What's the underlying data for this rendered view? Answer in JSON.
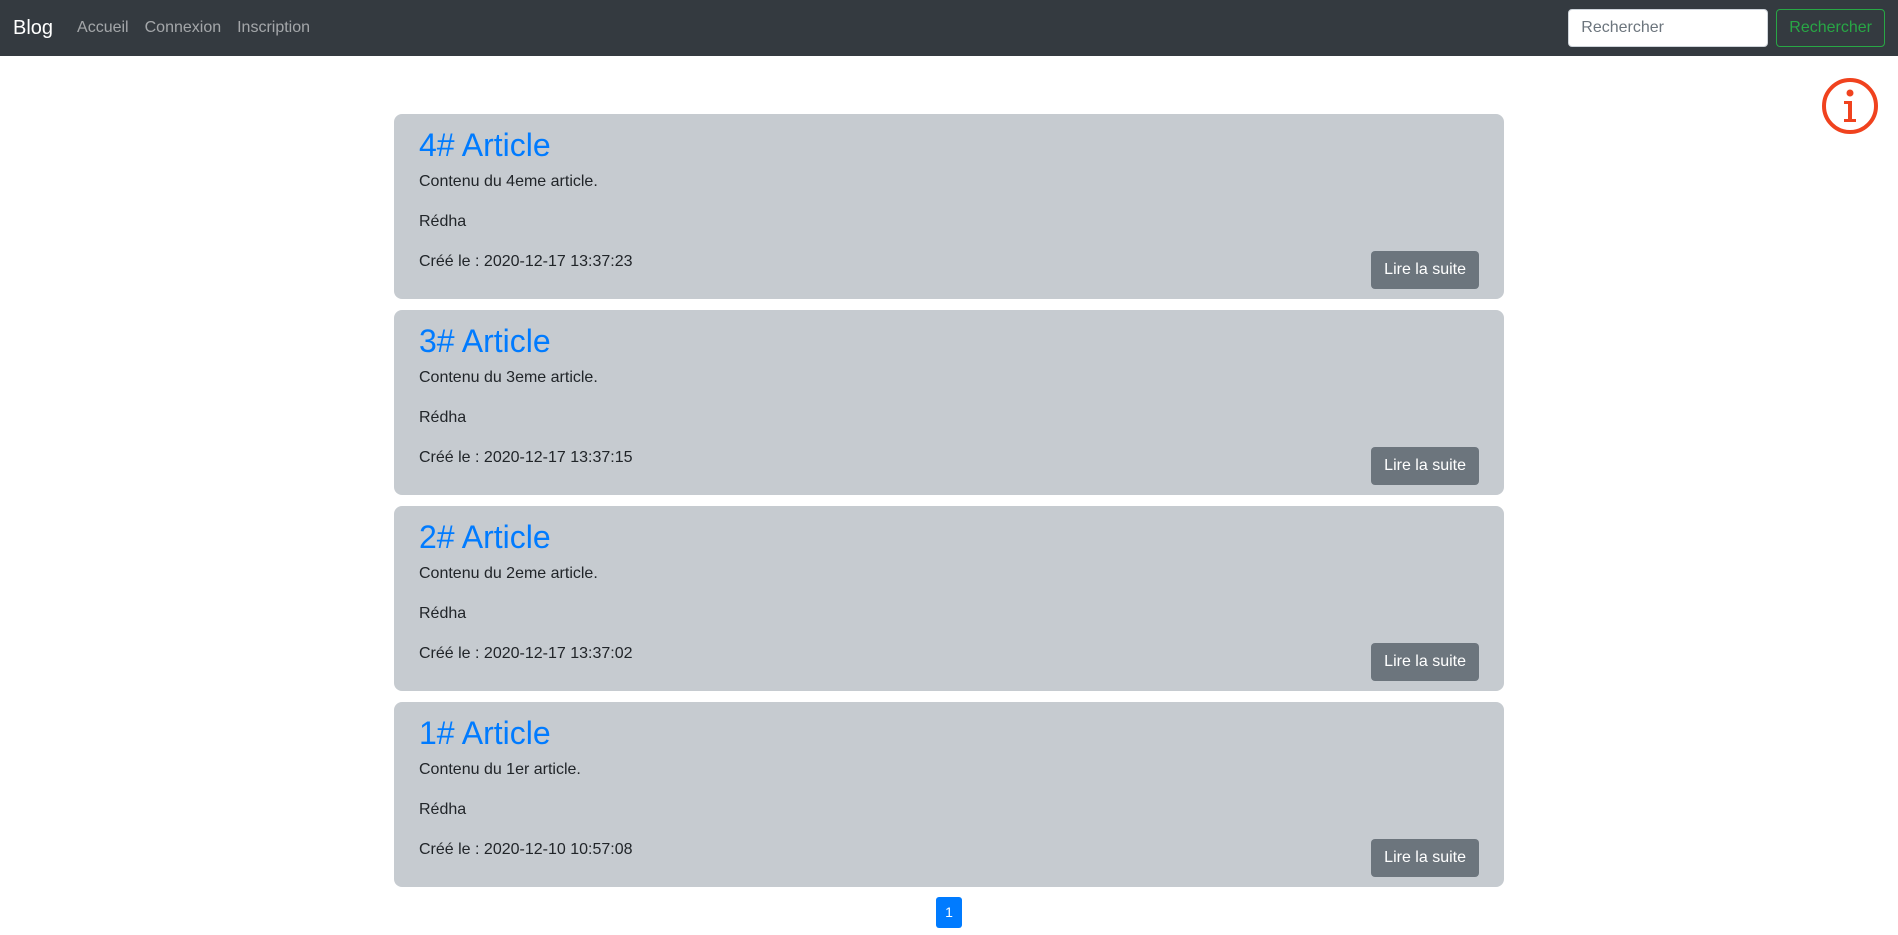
{
  "navbar": {
    "brand": "Blog",
    "links": [
      "Accueil",
      "Connexion",
      "Inscription"
    ],
    "search_placeholder": "Rechercher",
    "search_button": "Rechercher"
  },
  "articles": [
    {
      "title": "4# Article",
      "content": "Contenu du 4eme article.",
      "author": "Rédha",
      "created": "Créé le : 2020-12-17 13:37:23",
      "button": "Lire la suite"
    },
    {
      "title": "3# Article",
      "content": "Contenu du 3eme article.",
      "author": "Rédha",
      "created": "Créé le : 2020-12-17 13:37:15",
      "button": "Lire la suite"
    },
    {
      "title": "2# Article",
      "content": "Contenu du 2eme article.",
      "author": "Rédha",
      "created": "Créé le : 2020-12-17 13:37:02",
      "button": "Lire la suite"
    },
    {
      "title": "1# Article",
      "content": "Contenu du 1er article.",
      "author": "Rédha",
      "created": "Créé le : 2020-12-10 10:57:08",
      "button": "Lire la suite"
    }
  ],
  "pagination": {
    "current": "1"
  },
  "icons": {
    "info": "info-circle-icon"
  },
  "colors": {
    "navbar": "#343a40",
    "card": "#c6cbd0",
    "link": "#007bff",
    "success": "#28a745",
    "info_icon": "#f0421e"
  }
}
